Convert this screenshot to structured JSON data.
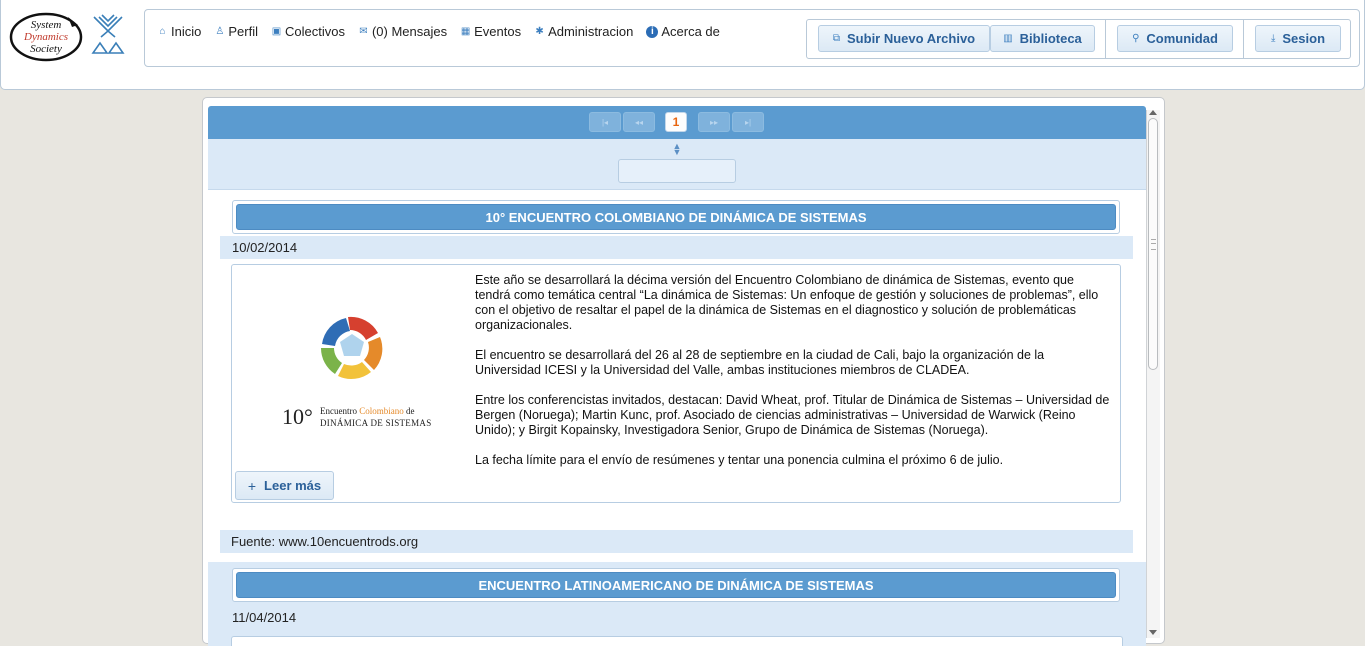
{
  "header": {
    "logo_text": [
      "System",
      "Dynamics",
      "Society"
    ],
    "nav": [
      {
        "icon": "home-icon",
        "glyph": "⌂",
        "label": "Inicio"
      },
      {
        "icon": "user-icon",
        "glyph": "♙",
        "label": "Perfil"
      },
      {
        "icon": "group-icon",
        "glyph": "▣",
        "label": "Colectivos"
      },
      {
        "icon": "mail-icon",
        "glyph": "✉",
        "label": "(0) Mensajes"
      },
      {
        "icon": "calendar-icon",
        "glyph": "▦",
        "label": "Eventos"
      },
      {
        "icon": "gear-icon",
        "glyph": "✱",
        "label": "Administracion"
      },
      {
        "icon": "info-icon",
        "glyph": "i",
        "label": "Acerca de"
      }
    ],
    "toolbar": {
      "upload_label": "Subir Nuevo Archivo",
      "library_label": "Biblioteca",
      "community_label": "Comunidad",
      "session_label": "Sesion"
    }
  },
  "pager": {
    "first": "|◂",
    "prev": "◂◂",
    "current_page": "1",
    "next": "▸▸",
    "last": "▸|"
  },
  "items": [
    {
      "title": "10° ENCUENTRO COLOMBIANO DE DINÁMICA DE SISTEMAS",
      "date": "10/02/2014",
      "image_caption": {
        "number": "10°",
        "line1_a": "Encuentro ",
        "line1_b": "Colombiano",
        "line1_c": " de",
        "line2": "dinámica de sistemas"
      },
      "paragraphs": [
        "Este año se desarrollará la décima versión del Encuentro Colombiano de dinámica de Sistemas, evento que tendrá como temática central “La dinámica de Sistemas: Un enfoque de gestión y soluciones de problemas”, ello con el objetivo de resaltar el papel de la dinámica de Sistemas en el diagnostico y solución de problemáticas organizacionales.",
        "El encuentro se desarrollará del 26 al 28 de septiembre en la ciudad de Cali, bajo la organización de la Universidad ICESI y la Universidad del Valle, ambas instituciones miembros de CLADEA.",
        "Entre los conferencistas invitados, destacan: David Wheat, prof.  Titular de Dinámica de Sistemas – Universidad de Bergen (Noruega); Martin Kunc, prof. Asociado de ciencias administrativas – Universidad de Warwick (Reino Unido); y Birgit Kopainsky, Investigadora Senior, Grupo de Dinámica de Sistemas (Noruega).",
        "La fecha límite para el envío de resúmenes y tentar una ponencia culmina el próximo 6 de julio."
      ],
      "read_more_label": "Leer más",
      "source": "Fuente: www.10encuentrods.org"
    },
    {
      "title": "ENCUENTRO LATINOAMERICANO DE DINÁMICA DE SISTEMAS",
      "date": "11/04/2014"
    }
  ],
  "colors": {
    "accent": "#5b9bd0",
    "light_band": "#dbe9f7",
    "button_text": "#2b6099",
    "current_page": "#e8650f"
  }
}
